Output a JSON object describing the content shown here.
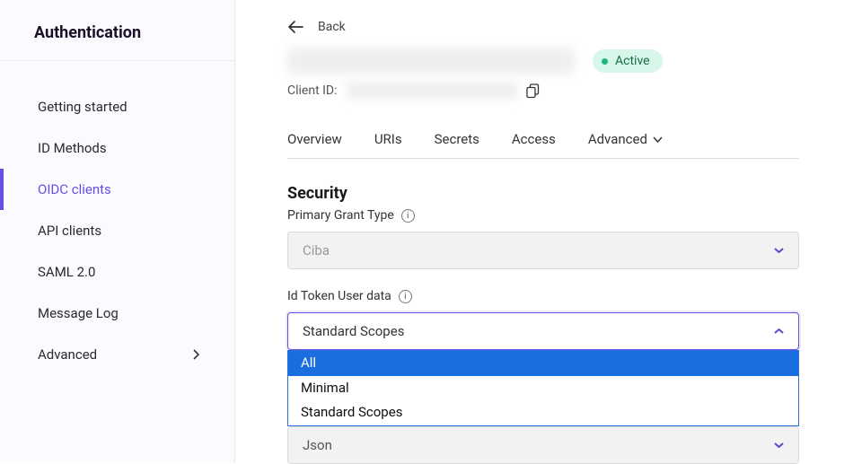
{
  "sidebar": {
    "title": "Authentication",
    "items": [
      {
        "label": "Getting started",
        "active": false
      },
      {
        "label": "ID Methods",
        "active": false
      },
      {
        "label": "OIDC clients",
        "active": true
      },
      {
        "label": "API clients",
        "active": false
      },
      {
        "label": "SAML 2.0",
        "active": false
      },
      {
        "label": "Message Log",
        "active": false
      },
      {
        "label": "Advanced",
        "active": false,
        "expandable": true
      }
    ]
  },
  "header": {
    "back_label": "Back",
    "status_label": "Active",
    "client_id_label": "Client ID:"
  },
  "tabs": [
    {
      "label": "Overview"
    },
    {
      "label": "URIs"
    },
    {
      "label": "Secrets"
    },
    {
      "label": "Access"
    },
    {
      "label": "Advanced",
      "has_submenu": true
    }
  ],
  "section": {
    "title": "Security",
    "primary_grant": {
      "label": "Primary Grant Type",
      "value": "Ciba"
    },
    "id_token": {
      "label": "Id Token User data",
      "selected": "Standard Scopes",
      "options": [
        "All",
        "Minimal",
        "Standard Scopes"
      ],
      "highlighted": "All"
    },
    "format_select": {
      "value": "Json"
    }
  }
}
